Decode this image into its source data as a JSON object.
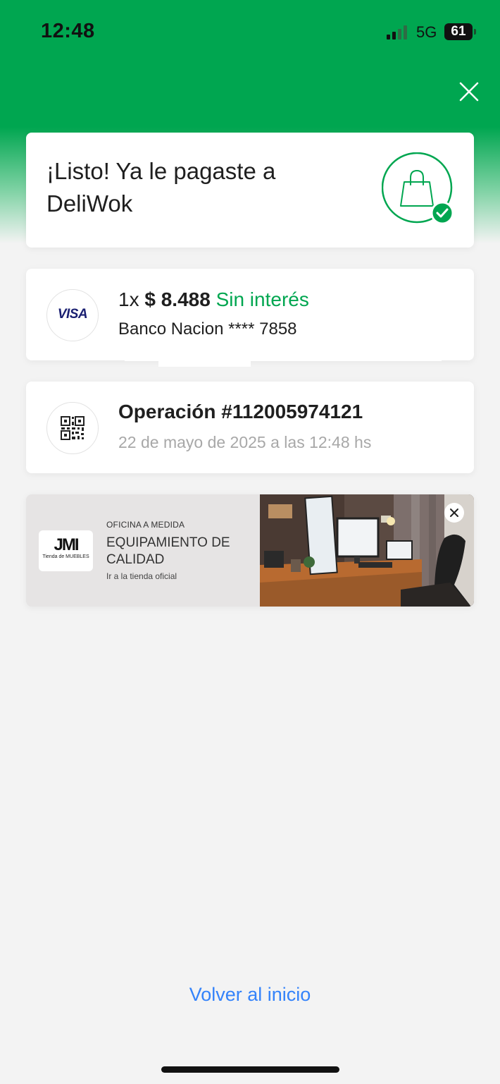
{
  "status_bar": {
    "time": "12:48",
    "network": "5G",
    "battery": "61"
  },
  "header": {
    "close_icon": "close-icon",
    "accent": "#00a650"
  },
  "confirmation": {
    "title": "¡Listo! Ya le pagaste a DeliWok",
    "icon": "shopping-bag-check-icon"
  },
  "payment": {
    "card_brand": "VISA",
    "quantity": "1x",
    "amount": "$ 8.488",
    "interest_label": "Sin interés",
    "bank_line": "Banco Nacion **** 7858"
  },
  "operation": {
    "title": "Operación #112005974121",
    "date": "22 de mayo de 2025 a las 12:48 hs",
    "icon": "qr-code-icon"
  },
  "banner": {
    "logo_mark": "JMI",
    "logo_sub": "Tienda de MUEBLES",
    "eyebrow": "OFICINA A MEDIDA",
    "title": "EQUIPAMIENTO DE CALIDAD",
    "link": "Ir a la tienda oficial",
    "close_icon": "close-icon"
  },
  "footer": {
    "back_label": "Volver al inicio",
    "link_color": "#3483fa"
  }
}
